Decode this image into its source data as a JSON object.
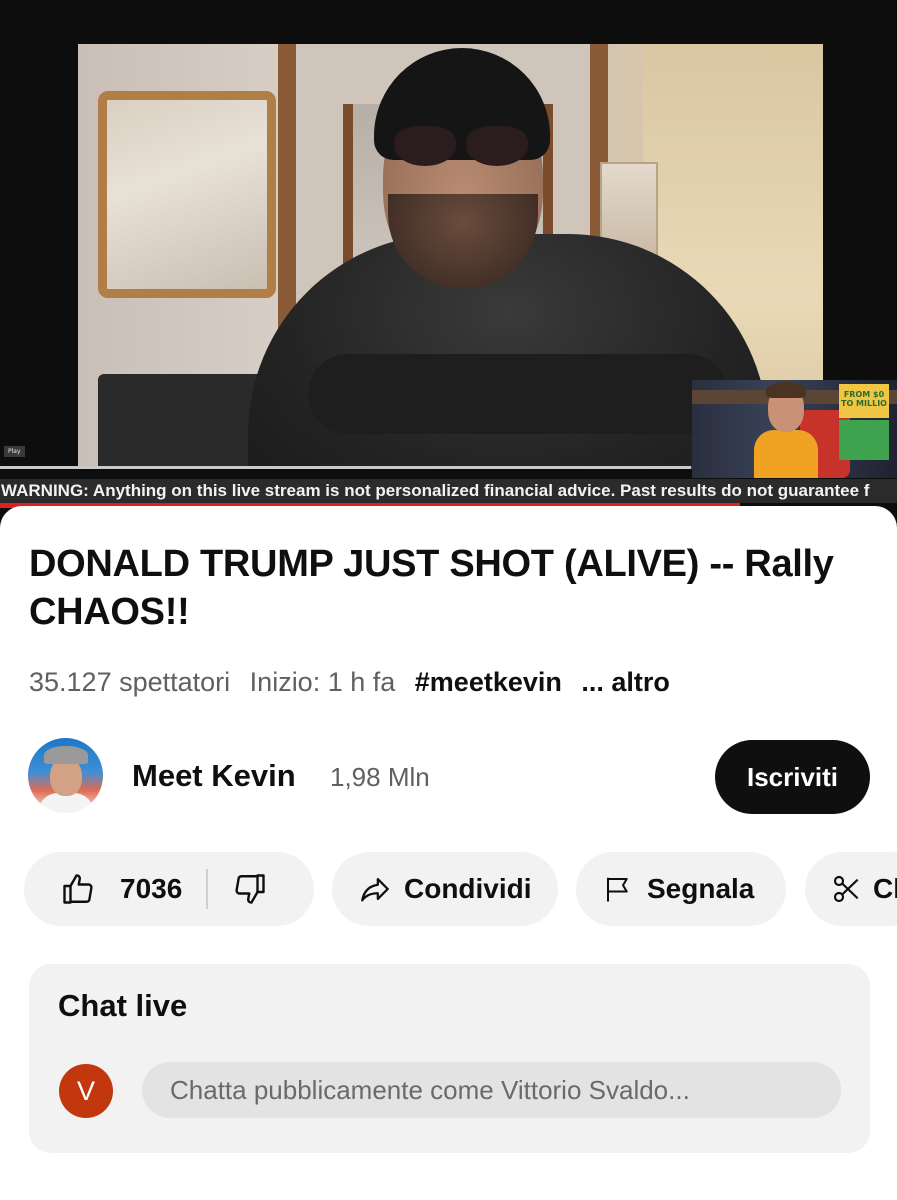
{
  "player": {
    "play_tag": "Play",
    "progress_fraction": 0.77,
    "ticker": "WARNING: Anything on this live stream is not personalized financial advice. Past results do not guarantee f",
    "pip_sign": "FROM $0 TO MILLIO"
  },
  "video": {
    "title": "DONALD TRUMP JUST SHOT (ALIVE) -- Rally CHAOS!!",
    "viewers": "35.127 spettatori",
    "started": "Inizio: 1 h fa",
    "hashtag": "#meetkevin",
    "more": "... altro"
  },
  "channel": {
    "name": "Meet Kevin",
    "subscribers": "1,98 Mln",
    "subscribe_label": "Iscriviti"
  },
  "actions": {
    "like_count": "7036",
    "share_label": "Condividi",
    "report_label": "Segnala",
    "clip_label": "Cl"
  },
  "chat": {
    "title": "Chat live",
    "avatar_letter": "V",
    "placeholder": "Chatta pubblicamente come Vittorio Svaldo..."
  },
  "icons": {
    "like": "thumbs-up-icon",
    "dislike": "thumbs-down-icon",
    "share": "share-arrow-icon",
    "report": "flag-icon",
    "clip": "scissors-icon"
  },
  "colors": {
    "subscribe_bg": "#0f0f0f",
    "pill_bg": "#f2f2f2",
    "ticker_accent": "#e02020",
    "chat_avatar": "#c2370d"
  }
}
